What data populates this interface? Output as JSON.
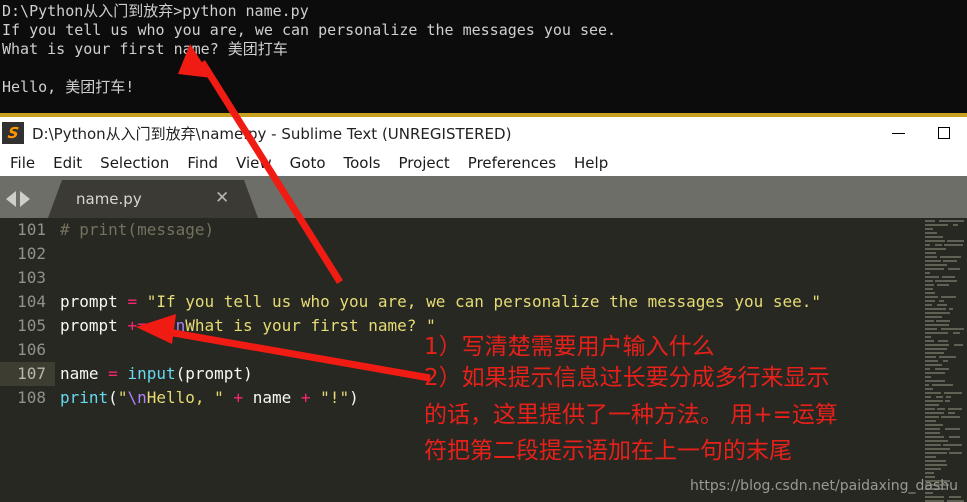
{
  "terminal": {
    "lines": [
      "D:\\Python从入门到放弃>python name.py",
      "If you tell us who you are, we can personalize the messages you see.",
      "What is your first name? 美团打车",
      "",
      "Hello, 美团打车!"
    ]
  },
  "titlebar": {
    "logo_glyph": "S",
    "title": "D:\\Python从入门到放弃\\name.py - Sublime Text (UNREGISTERED)",
    "minimize_label": "−",
    "maximize_label": "□"
  },
  "menubar": {
    "items": [
      "File",
      "Edit",
      "Selection",
      "Find",
      "View",
      "Goto",
      "Tools",
      "Project",
      "Preferences",
      "Help"
    ]
  },
  "tabbar": {
    "prev_arrow": "◀",
    "next_arrow": "▶",
    "active_tab": "name.py",
    "close_glyph": "✕"
  },
  "editor": {
    "line_numbers": [
      "101",
      "102",
      "103",
      "104",
      "105",
      "106",
      "107",
      "108"
    ],
    "active_line": "107",
    "code": {
      "l101_comment": "# print(message)",
      "l104_var": "prompt",
      "l104_op": "=",
      "l104_str": "\"If you tell us who you are, we can personalize the messages you see.\"",
      "l105_var": "prompt",
      "l105_op": "+=",
      "l105_quote_open": "\"",
      "l105_esc": "\\n",
      "l105_str": "What is your first name? ",
      "l105_quote_close": "\"",
      "l107_var": "name",
      "l107_op": "=",
      "l107_fn": "input",
      "l107_open": "(",
      "l107_arg": "prompt",
      "l107_close": ")",
      "l108_fn": "print",
      "l108_open": "(",
      "l108_quote_open": "\"",
      "l108_esc": "\\n",
      "l108_str": "Hello, ",
      "l108_quote_close": "\"",
      "l108_plus1": "+",
      "l108_name": "name",
      "l108_plus2": "+",
      "l108_bang": "\"!\"",
      "l108_close": ")"
    }
  },
  "annotations": {
    "line1": "1）写清楚需要用户输入什么",
    "line2": "2）如果提示信息过长要分成多行来显示",
    "line3": "的话，这里提供了一种方法。 用+=运算",
    "line4": "符把第二段提示语加在上一句的末尾"
  },
  "watermark": {
    "text": "https://blog.csdn.net/paidaxing_dashu"
  },
  "colors": {
    "annotation_red": "#e8201a",
    "editor_bg": "#272822",
    "terminal_bg": "#0c0c0c",
    "string_yellow": "#e6db74",
    "operator_pink": "#f92672",
    "function_cyan": "#66d9ef",
    "escape_purple": "#ae81ff"
  }
}
